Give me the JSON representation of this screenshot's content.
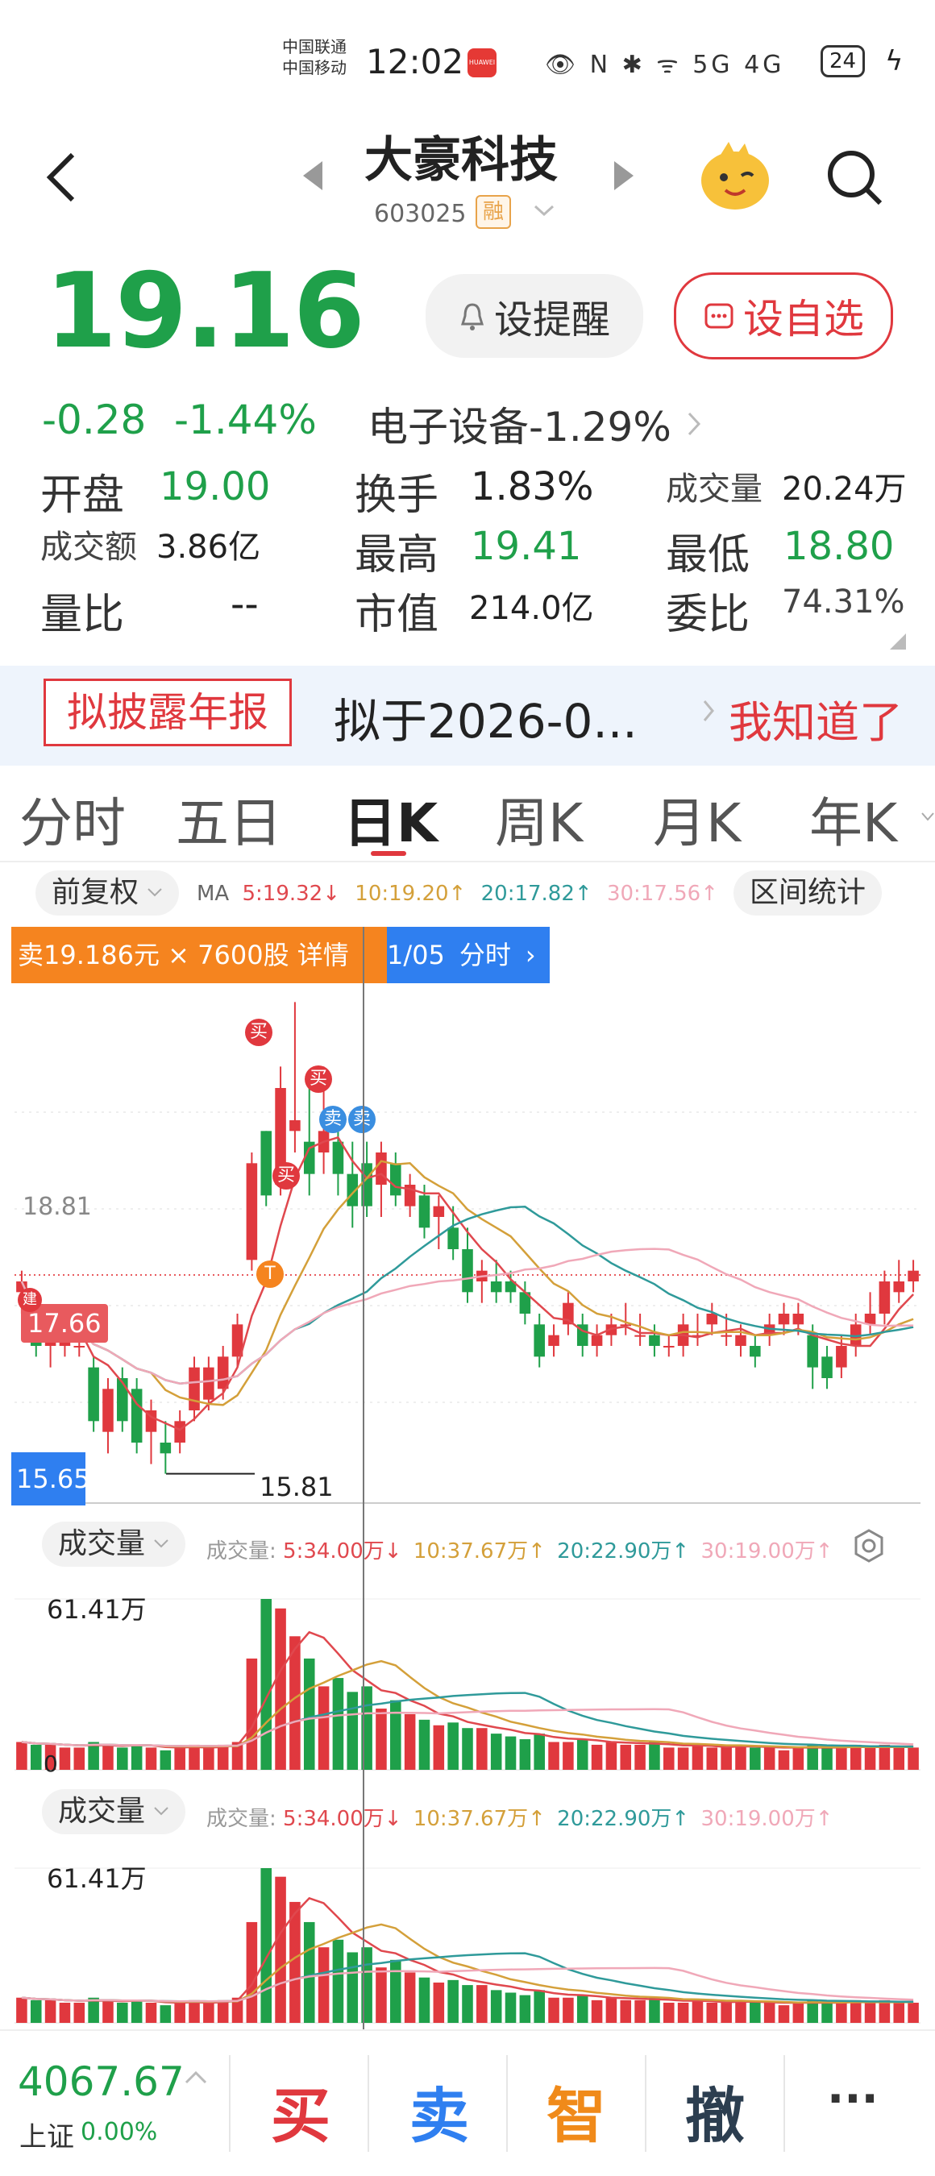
{
  "status_bar": {
    "carrier1": "中国联通",
    "carrier2": "中国移动",
    "time": "12:02",
    "app_badge": "HUAWEI",
    "icons": "👁 N ✱ ᯤ 5G 4G",
    "battery": "24"
  },
  "header": {
    "title": "大豪科技",
    "code": "603025",
    "margin_tag": "融",
    "back_icon": "chevron-left-icon",
    "prev_icon": "triangle-left-icon",
    "next_icon": "triangle-right-icon",
    "search_icon": "search-icon",
    "mascot_icon": "mascot-icon"
  },
  "quote": {
    "price": "19.16",
    "change": "-0.28",
    "change_pct": "-1.44%",
    "sector": "电子设备-1.29%",
    "remind_label": "设提醒",
    "fav_label": "设自选"
  },
  "stats": {
    "open_label": "开盘",
    "open_value": "19.00",
    "turnover_label": "换手",
    "turnover_value": "1.83%",
    "volume_label": "成交量",
    "volume_value": "20.24万",
    "amount_label": "成交额",
    "amount_value": "3.86亿",
    "high_label": "最高",
    "high_value": "19.41",
    "low_label": "最低",
    "low_value": "18.80",
    "ratio_label": "量比",
    "ratio_value": "--",
    "mktcap_label": "市值",
    "mktcap_value": "214.0亿",
    "commit_label": "委比",
    "commit_value": "74.31%"
  },
  "notice": {
    "tag": "拟披露年报",
    "text": "拟于2026-0...",
    "ok": "我知道了"
  },
  "tabs": [
    "分时",
    "五日",
    "日K",
    "周K",
    "月K",
    "年K"
  ],
  "kline": {
    "adjust_label": "前复权",
    "ma_label": "MA",
    "ma5": "5:19.32↓",
    "ma10": "10:19.20↑",
    "ma20": "20:17.82↑",
    "ma30": "30:17.56↑",
    "range_stat": "区间统计",
    "tooltip_trade": "卖19.186元 × 7600股 详情",
    "tooltip_date": "1/05",
    "tooltip_time": "分时",
    "price_high_label": "18.81",
    "price_current_label": "17.66",
    "price_low_label": "15.65",
    "low_point_label": "15.81",
    "buy_mark": "买",
    "sell_mark": "卖",
    "t_mark": "T",
    "jian_mark": "建"
  },
  "volume1": {
    "label": "成交量",
    "prefix": "成交量:",
    "ma5": "5:34.00万↓",
    "ma10": "10:37.67万↑",
    "ma20": "20:22.90万↑",
    "ma30": "30:19.00万↑",
    "max_label": "61.41万",
    "zero_label": "0"
  },
  "volume2": {
    "label": "成交量",
    "prefix": "成交量:",
    "ma5": "5:34.00万↓",
    "ma10": "10:37.67万↑",
    "ma20": "20:22.90万↑",
    "ma30": "30:19.00万↑",
    "max_label": "61.41万"
  },
  "bottom": {
    "index_value": "4067.67",
    "index_name": "上证",
    "index_change": "0.00%",
    "buy": "买",
    "sell": "卖",
    "smart": "智",
    "cancel": "撤",
    "more": "···"
  },
  "colors": {
    "up": "#e0383e",
    "down": "#1fa04a",
    "ma5": "#e0484e",
    "ma10": "#d4a03a",
    "ma20": "#2f9a9a",
    "ma30": "#f0a8b8",
    "tooltip_orange": "#f5841f",
    "tooltip_blue": "#2f7ff0"
  },
  "chart_data": {
    "type": "candlestick",
    "note_units": "price (CNY)",
    "ylim": [
      15.65,
      19.41
    ],
    "candles": [
      {
        "o": 17.5,
        "h": 17.7,
        "l": 17.3,
        "c": 17.6
      },
      {
        "o": 17.3,
        "h": 17.5,
        "l": 16.9,
        "c": 17.0
      },
      {
        "o": 17.0,
        "h": 17.2,
        "l": 16.8,
        "c": 17.1
      },
      {
        "o": 17.0,
        "h": 17.2,
        "l": 16.9,
        "c": 17.1
      },
      {
        "o": 17.0,
        "h": 17.2,
        "l": 16.9,
        "c": 17.0
      },
      {
        "o": 16.8,
        "h": 16.9,
        "l": 16.2,
        "c": 16.3
      },
      {
        "o": 16.2,
        "h": 16.7,
        "l": 16.0,
        "c": 16.6
      },
      {
        "o": 16.7,
        "h": 16.8,
        "l": 16.2,
        "c": 16.3
      },
      {
        "o": 16.6,
        "h": 16.7,
        "l": 16.0,
        "c": 16.1
      },
      {
        "o": 16.2,
        "h": 16.5,
        "l": 15.9,
        "c": 16.4
      },
      {
        "o": 16.1,
        "h": 16.3,
        "l": 15.81,
        "c": 16.0
      },
      {
        "o": 16.1,
        "h": 16.4,
        "l": 16.0,
        "c": 16.3
      },
      {
        "o": 16.4,
        "h": 16.9,
        "l": 16.3,
        "c": 16.8
      },
      {
        "o": 16.5,
        "h": 16.9,
        "l": 16.4,
        "c": 16.8
      },
      {
        "o": 16.6,
        "h": 17.0,
        "l": 16.5,
        "c": 16.9
      },
      {
        "o": 16.9,
        "h": 17.3,
        "l": 16.8,
        "c": 17.2
      },
      {
        "o": 17.8,
        "h": 18.8,
        "l": 17.7,
        "c": 18.7
      },
      {
        "o": 19.0,
        "h": 19.0,
        "l": 18.3,
        "c": 18.4
      },
      {
        "o": 18.5,
        "h": 19.6,
        "l": 18.4,
        "c": 19.4
      },
      {
        "o": 19.0,
        "h": 20.2,
        "l": 18.8,
        "c": 19.1
      },
      {
        "o": 18.9,
        "h": 19.5,
        "l": 18.4,
        "c": 18.6
      },
      {
        "o": 18.8,
        "h": 19.6,
        "l": 18.6,
        "c": 19.0
      },
      {
        "o": 18.9,
        "h": 19.1,
        "l": 18.4,
        "c": 18.6
      },
      {
        "o": 18.6,
        "h": 18.9,
        "l": 18.1,
        "c": 18.3
      },
      {
        "o": 18.7,
        "h": 18.9,
        "l": 18.2,
        "c": 18.3
      },
      {
        "o": 18.5,
        "h": 18.9,
        "l": 18.2,
        "c": 18.8
      },
      {
        "o": 18.7,
        "h": 18.8,
        "l": 18.3,
        "c": 18.4
      },
      {
        "o": 18.3,
        "h": 18.6,
        "l": 18.2,
        "c": 18.5
      },
      {
        "o": 18.4,
        "h": 18.5,
        "l": 18.0,
        "c": 18.1
      },
      {
        "o": 18.2,
        "h": 18.4,
        "l": 17.9,
        "c": 18.3
      },
      {
        "o": 18.1,
        "h": 18.3,
        "l": 17.8,
        "c": 17.9
      },
      {
        "o": 17.9,
        "h": 18.1,
        "l": 17.4,
        "c": 17.5
      },
      {
        "o": 17.6,
        "h": 17.8,
        "l": 17.4,
        "c": 17.7
      },
      {
        "o": 17.6,
        "h": 17.8,
        "l": 17.4,
        "c": 17.5
      },
      {
        "o": 17.6,
        "h": 17.7,
        "l": 17.4,
        "c": 17.5
      },
      {
        "o": 17.5,
        "h": 17.6,
        "l": 17.2,
        "c": 17.3
      },
      {
        "o": 17.2,
        "h": 17.3,
        "l": 16.8,
        "c": 16.9
      },
      {
        "o": 17.0,
        "h": 17.2,
        "l": 16.9,
        "c": 17.1
      },
      {
        "o": 17.2,
        "h": 17.5,
        "l": 17.1,
        "c": 17.4
      },
      {
        "o": 17.2,
        "h": 17.3,
        "l": 16.9,
        "c": 17.0
      },
      {
        "o": 17.0,
        "h": 17.2,
        "l": 16.9,
        "c": 17.1
      },
      {
        "o": 17.1,
        "h": 17.3,
        "l": 17.0,
        "c": 17.2
      },
      {
        "o": 17.2,
        "h": 17.4,
        "l": 17.1,
        "c": 17.2
      },
      {
        "o": 17.1,
        "h": 17.3,
        "l": 17.0,
        "c": 17.1
      },
      {
        "o": 17.1,
        "h": 17.2,
        "l": 16.9,
        "c": 17.0
      },
      {
        "o": 17.0,
        "h": 17.1,
        "l": 16.9,
        "c": 17.0
      },
      {
        "o": 17.0,
        "h": 17.3,
        "l": 16.9,
        "c": 17.2
      },
      {
        "o": 17.1,
        "h": 17.3,
        "l": 17.0,
        "c": 17.1
      },
      {
        "o": 17.2,
        "h": 17.4,
        "l": 17.1,
        "c": 17.3
      },
      {
        "o": 17.1,
        "h": 17.3,
        "l": 17.0,
        "c": 17.1
      },
      {
        "o": 17.0,
        "h": 17.2,
        "l": 16.9,
        "c": 17.1
      },
      {
        "o": 17.0,
        "h": 17.1,
        "l": 16.8,
        "c": 16.9
      },
      {
        "o": 17.1,
        "h": 17.3,
        "l": 17.0,
        "c": 17.2
      },
      {
        "o": 17.2,
        "h": 17.4,
        "l": 17.1,
        "c": 17.3
      },
      {
        "o": 17.2,
        "h": 17.4,
        "l": 17.1,
        "c": 17.3
      },
      {
        "o": 17.1,
        "h": 17.2,
        "l": 16.6,
        "c": 16.8
      },
      {
        "o": 16.9,
        "h": 17.0,
        "l": 16.6,
        "c": 16.7
      },
      {
        "o": 16.8,
        "h": 17.1,
        "l": 16.7,
        "c": 17.0
      },
      {
        "o": 17.0,
        "h": 17.3,
        "l": 16.9,
        "c": 17.2
      },
      {
        "o": 17.2,
        "h": 17.5,
        "l": 17.1,
        "c": 17.3
      },
      {
        "o": 17.3,
        "h": 17.7,
        "l": 17.2,
        "c": 17.6
      },
      {
        "o": 17.5,
        "h": 17.8,
        "l": 17.4,
        "c": 17.6
      },
      {
        "o": 17.6,
        "h": 17.8,
        "l": 17.5,
        "c": 17.7
      }
    ],
    "volumes": [
      10,
      9,
      9,
      8,
      8,
      10,
      9,
      8,
      9,
      8,
      7,
      8,
      9,
      8,
      9,
      10,
      40,
      61.41,
      58,
      48,
      40,
      30,
      33,
      28,
      30,
      22,
      25,
      20,
      18,
      16,
      17,
      15,
      15,
      13,
      12,
      11,
      13,
      10,
      10,
      11,
      9,
      10,
      9,
      9,
      10,
      8,
      8,
      9,
      8,
      8,
      9,
      8,
      8,
      7,
      8,
      9,
      8,
      8,
      9,
      8,
      9,
      8,
      8
    ]
  }
}
